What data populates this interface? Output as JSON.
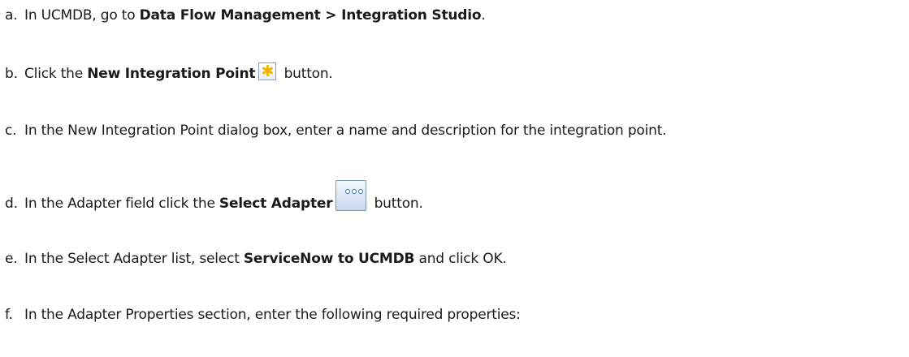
{
  "steps": [
    {
      "letter": "a.",
      "parts": [
        "In UCMDB, go to ",
        "Data Flow Management > Integration Studio",
        "."
      ]
    },
    {
      "letter": "b.",
      "parts": [
        "Click the ",
        "New Integration Point",
        " button."
      ],
      "icon": "new-integration-point-icon"
    },
    {
      "letter": "c.",
      "parts": [
        "In the New Integration Point dialog box, enter a name and description for the integration point."
      ]
    },
    {
      "letter": "d.",
      "parts": [
        "In the Adapter field click the ",
        "Select Adapter",
        " button."
      ],
      "icon": "select-adapter-icon"
    },
    {
      "letter": "e.",
      "parts": [
        "In the Select Adapter list, select ",
        "ServiceNow to UCMDB",
        " and click OK."
      ]
    },
    {
      "letter": "f.",
      "parts": [
        "In the Adapter Properties section, enter the following required properties:"
      ]
    }
  ]
}
